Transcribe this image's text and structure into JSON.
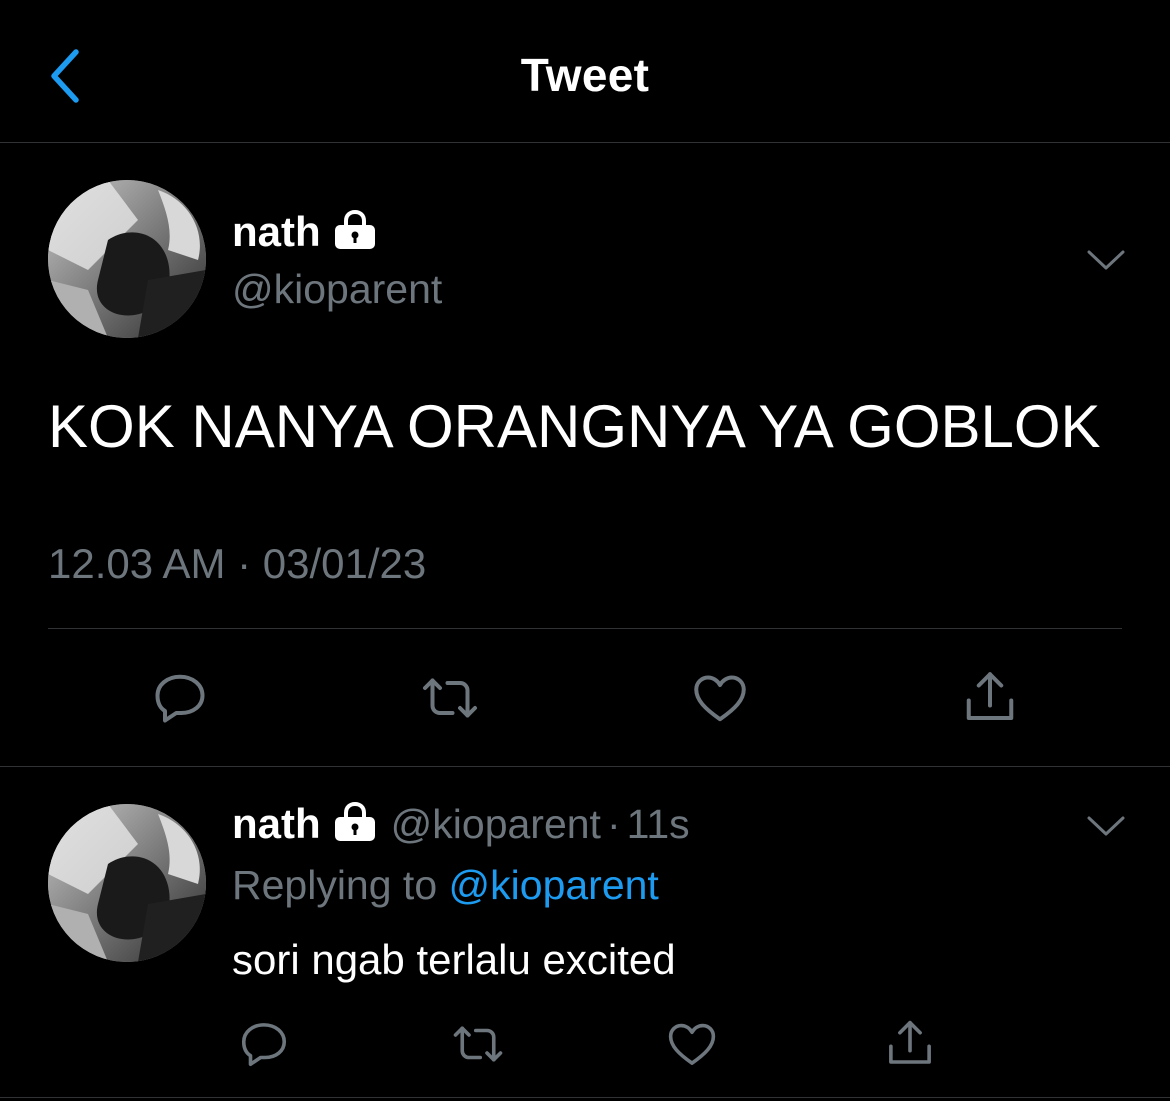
{
  "header": {
    "title": "Tweet",
    "back_icon": "chevron-left-icon"
  },
  "colors": {
    "background": "#000000",
    "text_primary": "#ffffff",
    "text_secondary": "#6e767d",
    "accent": "#1d9bf0",
    "divider": "#2f3336"
  },
  "main_tweet": {
    "author": {
      "display_name": "nath",
      "handle": "@kioparent",
      "protected_icon": "lock-icon"
    },
    "text": "KOK NANYA ORANGNYA YA GOBLOK",
    "timestamp": "12.03 AM · 03/01/23",
    "actions": [
      "reply-icon",
      "retweet-icon",
      "like-icon",
      "share-icon"
    ]
  },
  "reply": {
    "author": {
      "display_name": "nath",
      "handle": "@kioparent",
      "protected_icon": "lock-icon"
    },
    "separator": "·",
    "time_ago": "11s",
    "replying_prefix": "Replying to",
    "replying_to": "@kioparent",
    "text": "sori ngab terlalu excited",
    "actions": [
      "reply-icon",
      "retweet-icon",
      "like-icon",
      "share-icon"
    ]
  }
}
